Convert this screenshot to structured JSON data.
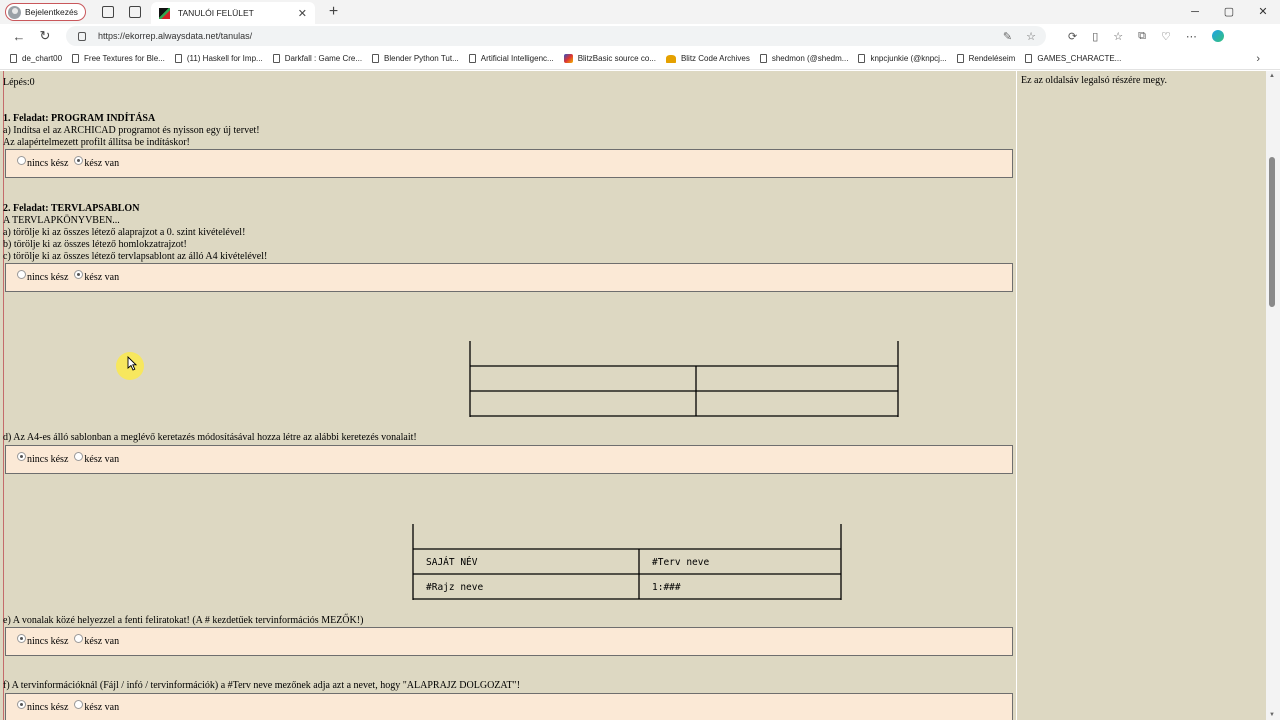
{
  "browser": {
    "profile_label": "Bejelentkezés",
    "tab_title": "TANULÓI FELÜLET",
    "url": "https://ekorrep.alwaysdata.net/tanulas/",
    "bookmarks": [
      {
        "label": "de_chart00",
        "icon": "doc-icon"
      },
      {
        "label": "Free Textures for Ble...",
        "icon": "doc-icon"
      },
      {
        "label": "(11) Haskell for Imp...",
        "icon": "doc-icon"
      },
      {
        "label": "Darkfall : Game Cre...",
        "icon": "doc-icon"
      },
      {
        "label": "Blender Python Tut...",
        "icon": "doc-icon"
      },
      {
        "label": "Artificial Intelligenc...",
        "icon": "doc-icon"
      },
      {
        "label": "BlitzBasic source co...",
        "icon": "blitz-icon"
      },
      {
        "label": "Blitz Code Archives",
        "icon": "blitz-archive-icon"
      },
      {
        "label": "shedmon (@shedm...",
        "icon": "doc-icon"
      },
      {
        "label": "knpcjunkie (@knpcj...",
        "icon": "doc-icon"
      },
      {
        "label": "Rendeléseim",
        "icon": "doc-icon"
      },
      {
        "label": "GAMES_CHARACTE...",
        "icon": "doc-icon"
      }
    ]
  },
  "page": {
    "step": "Lépés:0",
    "sidebar_text": "Ez az oldalsáv legalsó részére megy.",
    "radio_off_label": "nincs kész",
    "radio_on_label": "kész van",
    "task1": {
      "title": "1. Feladat: PROGRAM INDÍTÁSA",
      "lines": [
        "a) Indítsa el az ARCHICAD programot és nyisson egy új tervet!",
        "Az alapértelmezett profilt állítsa be indításkor!"
      ],
      "selected": "kész van"
    },
    "task2": {
      "title": "2. Feladat: TERVLAPSABLON",
      "lines": [
        "A TERVLAPKÖNYVBEN...",
        "a) törölje ki az összes létező alaprajzot a 0. szint kivételével!",
        "b) törölje ki az összes létező homlokzatrajzot!",
        "c) törölje ki az összes létező tervlapsablont az álló A4 kivételével!"
      ],
      "selected": "kész van"
    },
    "task_d": {
      "text": "d) Az A4-es álló sablonban a meglévő keretazés módosításával hozza létre az alábbi keretezés vonalait!",
      "selected": "nincs kész"
    },
    "table2": {
      "cells": [
        "SAJÁT NÉV",
        "#Terv neve",
        "#Rajz neve",
        "1:###"
      ]
    },
    "task_e": {
      "text": "e) A vonalak közé helyezzel a fenti feliratokat! (A # kezdetűek tervinformációs MEZŐK!)",
      "selected": "nincs kész"
    },
    "task_f": {
      "text": "f) A tervinformációknál (Fájl / infó / tervinformációk) a #Terv neve mezőnek adja azt a nevet, hogy \"ALAPRAJZ DOLGOZAT\"!",
      "selected": "nincs kész"
    }
  }
}
